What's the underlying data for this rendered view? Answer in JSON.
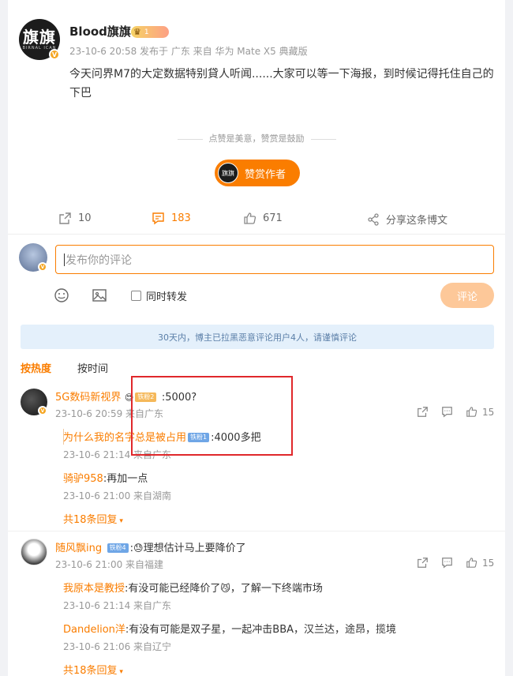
{
  "post": {
    "author": "Blood旗旗",
    "avatar_text": "旗旗",
    "avatar_sub": "BIRNAL ICAN",
    "crown_level": "1",
    "meta": "23-10-6 20:58 发布于 广东 来自 华为 Mate X5 典藏版",
    "text": "今天问界M7的大定数据特别貸人听闻......大家可以等一下海报，到时候记得托住自己的下巴",
    "divider": "点赞是美意，赞赏是鼓励",
    "reward_label": "赞赏作者",
    "reward_avatar": "旗旗"
  },
  "actions": {
    "repost": "10",
    "comments": "183",
    "likes": "671",
    "share": "分享这条博文"
  },
  "composer": {
    "placeholder": "发布你的评论",
    "repost_label": "同时转发",
    "submit_label": "评论"
  },
  "notice": "30天内，博主已拉黑恶意评论用户4人，请谨慎评论",
  "sort": {
    "hot": "按热度",
    "time": "按时间"
  },
  "comments": [
    {
      "name": "5G数码新视界",
      "tag": "铁粉2",
      "text": ":5000?",
      "meta": "23-10-6 20:59 来自广东",
      "likes": "15",
      "replies": [
        {
          "name": "为什么我的名字总是被占用",
          "tag": "铁粉1",
          "text": ":4000多把",
          "meta": "23-10-6 21:14 来自广东"
        },
        {
          "name": "骑驴958",
          "text": ":再加一点",
          "meta": "23-10-6 21:00 来自湖南"
        }
      ],
      "more": "共18条回复"
    },
    {
      "name": "随风飘ing",
      "tag": "铁粉4",
      "text": "理想估计马上要降价了",
      "meta": "23-10-6 21:00 来自福建",
      "likes": "15",
      "replies": [
        {
          "name": "我原本是教授",
          "text": ":有没可能已经降价了",
          "text2": "，了解一下终端市场",
          "meta": "23-10-6 21:14 来自广东"
        },
        {
          "name": "Dandelion洋",
          "text": ":有没有可能是双子星，一起冲击BBA，汉兰达，途昂，揽境",
          "meta": "23-10-6 21:06 来自辽宁"
        }
      ],
      "more": "共18条回复"
    }
  ],
  "colors": {
    "accent": "#fa7d00",
    "highlight_box": "#e0282b",
    "notice_bg": "#e4f0fb"
  }
}
